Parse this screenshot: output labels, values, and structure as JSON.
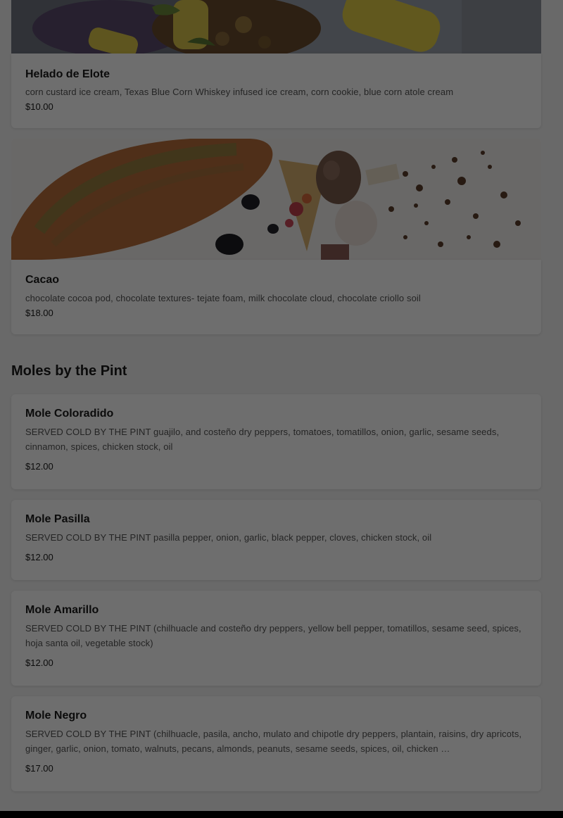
{
  "items_with_photos": [
    {
      "name": "Helado de Elote",
      "description": "corn custard ice cream, Texas Blue Corn Whiskey infused ice cream, corn cookie, blue corn atole cream",
      "price": "$10.00",
      "photo": "corn-dessert-photo"
    },
    {
      "name": "Cacao",
      "description": "chocolate cocoa pod, chocolate textures- tejate foam, milk chocolate cloud, chocolate criollo soil",
      "price": "$18.00",
      "photo": "chocolate-pod-dessert-photo"
    }
  ],
  "section": {
    "title": "Moles by the Pint"
  },
  "moles": [
    {
      "name": "Mole Coloradido",
      "description": "SERVED COLD BY THE PINT guajilo, and costeño dry peppers, tomatoes, tomatillos, onion, garlic, sesame seeds, cinnamon, spices, chicken stock, oil",
      "price": "$12.00"
    },
    {
      "name": "Mole Pasilla",
      "description": "SERVED COLD BY THE PINT pasilla pepper, onion, garlic, black pepper, cloves, chicken stock, oil",
      "price": "$12.00"
    },
    {
      "name": "Mole Amarillo",
      "description": "SERVED COLD BY THE PINT (chilhuacle and costeño dry peppers, yellow bell pepper, tomatillos, sesame seed, spices, hoja santa oil, vegetable stock)",
      "price": "$12.00"
    },
    {
      "name": "Mole Negro",
      "description": "SERVED COLD BY THE PINT (chilhuacle, pasila, ancho, mulato and chipotle dry peppers, plantain, raisins, dry apricots, ginger, garlic, onion, tomato, walnuts, pecans, almonds, peanuts, sesame seeds, spices, oil, chicken …",
      "price": "$17.00"
    }
  ],
  "colors": {
    "overlay": "#000000",
    "card": "#ffffff",
    "background": "#f4f4f4"
  }
}
